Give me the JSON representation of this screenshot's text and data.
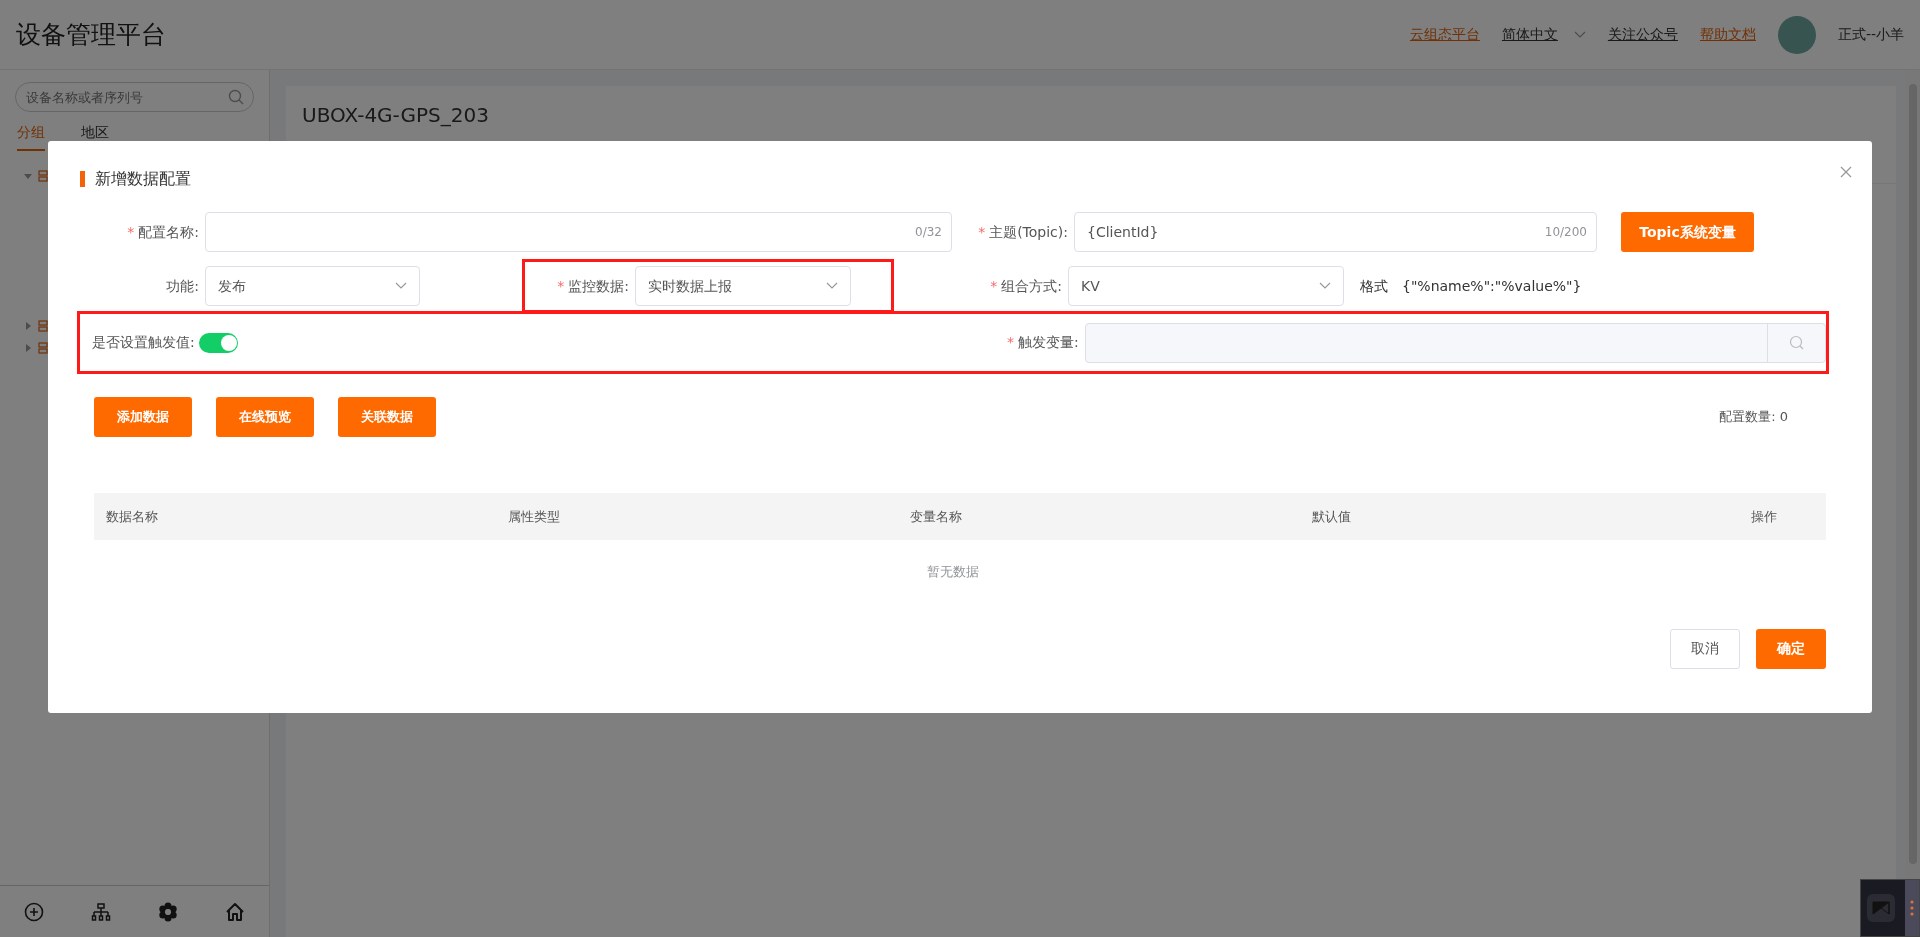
{
  "header": {
    "title": "设备管理平台",
    "links": [
      {
        "text": "云组态平台",
        "kind": "accent"
      },
      {
        "text": "简体中文",
        "kind": "dropdown"
      },
      {
        "text": "关注公众号",
        "kind": "plain"
      },
      {
        "text": "帮助文档",
        "kind": "accent"
      }
    ],
    "user": "正式--小羊"
  },
  "sidebar": {
    "search": {
      "placeholder": "设备名称或者序列号"
    },
    "tabs": [
      {
        "label": "分组",
        "selected": true
      },
      {
        "label": "地区",
        "selected": false
      }
    ],
    "tree": [
      {
        "expanded": true
      },
      {
        "expanded": false
      },
      {
        "expanded": false
      }
    ]
  },
  "content": {
    "title": "UBOX-4G-GPS_203"
  },
  "modal": {
    "title": "新增数据配置",
    "name_field": {
      "label": "配置名称:",
      "mark": "*",
      "counter": "0/32"
    },
    "topic_field": {
      "label": "主题(Topic):",
      "mark": "*",
      "value": "{ClientId}",
      "counter": "10/200"
    },
    "topic_button": "Topic系统变量",
    "function_select": {
      "label": "功能:",
      "value": "发布"
    },
    "monitor_select": {
      "label": "监控数据:",
      "mark": "*",
      "value": "实时数据上报",
      "highlighted": true
    },
    "combine_select": {
      "label": "组合方式:",
      "mark": "*",
      "value": "KV"
    },
    "format": {
      "label": "格式",
      "value": "{\"%name%\":\"%value%\"}"
    },
    "trigger_toggle": {
      "label": "是否设置触发值:",
      "on": true
    },
    "trigger_var": {
      "label": "触发变量:",
      "mark": "*"
    },
    "trigger_highlighted": true,
    "actions": [
      "添加数据",
      "在线预览",
      "关联数据"
    ],
    "count": "配置数量: 0",
    "table": {
      "columns": [
        "数据名称",
        "属性类型",
        "变量名称",
        "默认值",
        "操作"
      ],
      "empty": "暂无数据"
    },
    "cancel": "取消",
    "confirm": "确定"
  }
}
